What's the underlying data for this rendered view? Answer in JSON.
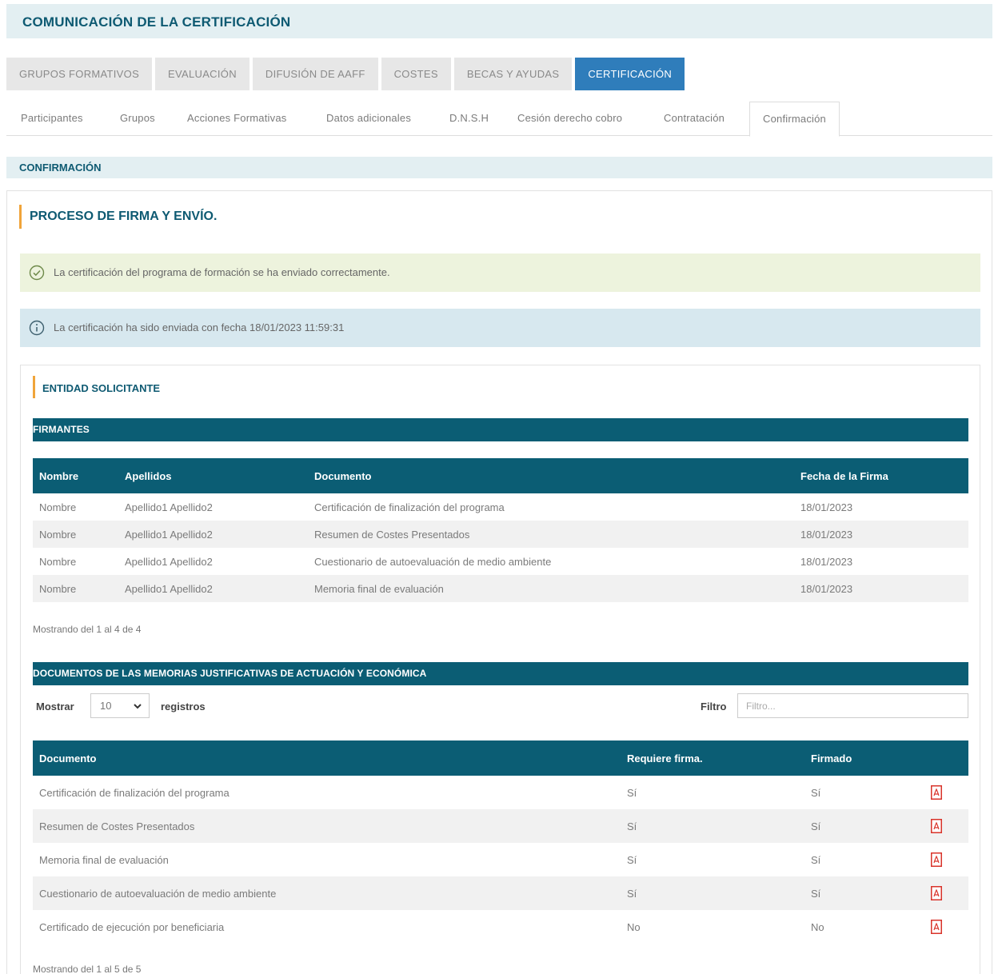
{
  "page_title": "COMUNICACIÓN DE LA CERTIFICACIÓN",
  "main_tabs": [
    {
      "label": "GRUPOS FORMATIVOS",
      "active": false
    },
    {
      "label": "EVALUACIÓN",
      "active": false
    },
    {
      "label": "DIFUSIÓN DE AAFF",
      "active": false
    },
    {
      "label": "COSTES",
      "active": false
    },
    {
      "label": "BECAS Y AYUDAS",
      "active": false
    },
    {
      "label": "CERTIFICACIÓN",
      "active": true
    }
  ],
  "sub_tabs": [
    {
      "label": "Participantes"
    },
    {
      "label": "Grupos"
    },
    {
      "label": "Acciones Formativas"
    },
    {
      "label": "Datos adicionales"
    },
    {
      "label": "D.N.S.H"
    },
    {
      "label": "Cesión derecho cobro"
    },
    {
      "label": "Contratación"
    },
    {
      "label": "Confirmación",
      "active": true
    }
  ],
  "section_title": "CONFIRMACIÓN",
  "process_heading": "PROCESO DE FIRMA Y ENVÍO.",
  "alerts": {
    "success": "La certificación del programa de formación se ha enviado correctamente.",
    "info": "La certificación ha sido enviada con fecha 18/01/2023 11:59:31"
  },
  "entity_heading": "ENTIDAD SOLICITANTE",
  "firmantes": {
    "title": "FIRMANTES",
    "columns": [
      "Nombre",
      "Apellidos",
      "Documento",
      "Fecha de la Firma"
    ],
    "rows": [
      [
        "Nombre",
        "Apellido1 Apellido2",
        "Certificación de finalización del programa",
        "18/01/2023"
      ],
      [
        "Nombre",
        "Apellido1 Apellido2",
        "Resumen de Costes Presentados",
        "18/01/2023"
      ],
      [
        "Nombre",
        "Apellido1 Apellido2",
        "Cuestionario de autoevaluación de medio ambiente",
        "18/01/2023"
      ],
      [
        "Nombre",
        "Apellido1 Apellido2",
        "Memoria final de evaluación",
        "18/01/2023"
      ]
    ],
    "showing": "Mostrando del 1 al 4 de 4"
  },
  "documentos": {
    "title": "DOCUMENTOS DE LAS MEMORIAS JUSTIFICATIVAS DE ACTUACIÓN Y ECONÓMICA",
    "show_label": "Mostrar",
    "show_value": "10",
    "records_label": "registros",
    "filter_label": "Filtro",
    "filter_placeholder": "Filtro...",
    "columns": [
      "Documento",
      "Requiere firma.",
      "Firmado",
      ""
    ],
    "rows": [
      [
        "Certificación de finalización del programa",
        "Sí",
        "Sí"
      ],
      [
        "Resumen de Costes Presentados",
        "Sí",
        "Sí"
      ],
      [
        "Memoria final de evaluación",
        "Sí",
        "Sí"
      ],
      [
        "Cuestionario de autoevaluación de medio ambiente",
        "Sí",
        "Sí"
      ],
      [
        "Certificado de ejecución por beneficiaria",
        "No",
        "No"
      ]
    ],
    "row_icon": "pdf-icon",
    "showing": "Mostrando del 1 al 5 de 5"
  },
  "colors": {
    "primary_dark": "#0b5d74",
    "title_text": "#0e5a72",
    "active_tab": "#2f7dbb",
    "accent": "#f0a43a",
    "success_bg": "#edf3dd",
    "info_bg": "#d7e8ef",
    "pdf_red": "#d9342b"
  }
}
